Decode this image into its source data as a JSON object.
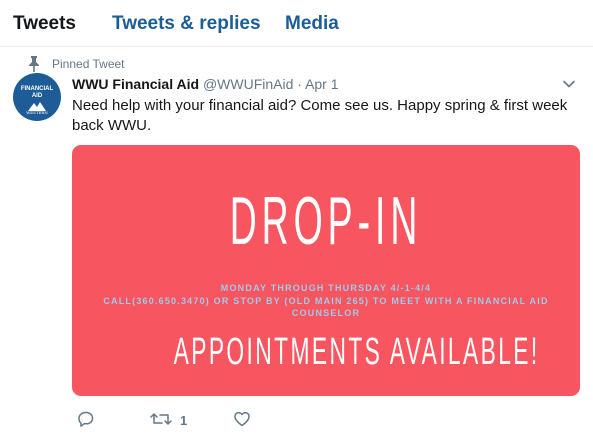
{
  "tabs": [
    {
      "label": "Tweets",
      "active": true
    },
    {
      "label": "Tweets & replies",
      "active": false
    },
    {
      "label": "Media",
      "active": false
    }
  ],
  "tweet": {
    "pinned_label": "Pinned Tweet",
    "avatar": {
      "line1": "FINANCIAL",
      "line2": "AID",
      "wordmark": "WESTERN"
    },
    "author_name": "WWU Financial Aid",
    "handle": "@WWUFinAid",
    "separator": "·",
    "date": "Apr 1",
    "text": "Need help with your financial aid?  Come see us.  Happy spring & first week back WWU.",
    "card": {
      "headline": "DROP-IN",
      "dates": "MONDAY THROUGH THURSDAY 4/-1-4/4",
      "info": "CALL(360.650.3470) OR STOP BY (OLD MAIN 265) TO MEET WITH A FINANCIAL AID COUNSELOR",
      "footer": "APPOINTMENTS AVAILABLE!",
      "background": "#f75560"
    },
    "actions": {
      "reply_count": "",
      "retweet_count": "1",
      "like_count": ""
    }
  },
  "colors": {
    "link_blue": "#1c5d99",
    "muted": "#657786",
    "card_subtext": "#a3c8e8"
  },
  "icons": [
    "pin-icon",
    "chevron-down-icon",
    "reply-icon",
    "retweet-icon",
    "heart-icon"
  ]
}
